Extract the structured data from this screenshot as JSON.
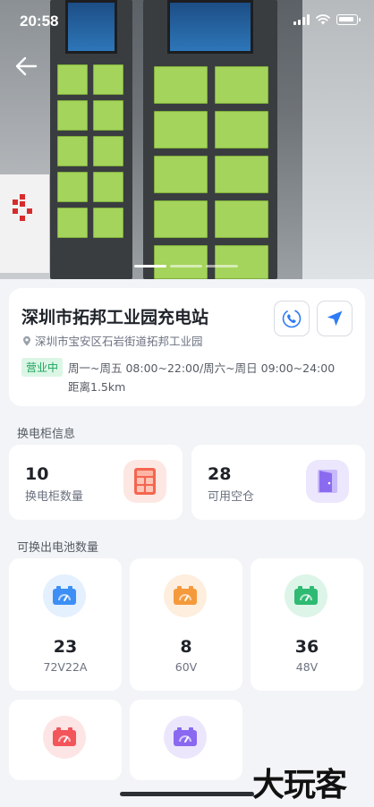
{
  "status_bar": {
    "time": "20:58"
  },
  "station": {
    "name": "深圳市拓邦工业园充电站",
    "address": "深圳市宝安区石岩街道拓邦工业园",
    "status": "营业中",
    "hours": "周一~周五 08:00~22:00/周六~周日 09:00~24:00",
    "distance": "距离1.5km"
  },
  "carousel": {
    "slide_count": 3,
    "active_index": 0
  },
  "cabinet_section": {
    "title": "换电柜信息",
    "stats": [
      {
        "value": "10",
        "label": "换电柜数量",
        "icon": "cabinet-icon",
        "color": "#f25c4f"
      },
      {
        "value": "28",
        "label": "可用空仓",
        "icon": "door-icon",
        "color": "#8a6bf0"
      }
    ]
  },
  "battery_section": {
    "title": "可换出电池数量",
    "items": [
      {
        "count": "23",
        "spec": "72V22A",
        "icon": "battery-icon",
        "color": "#3d8ff5",
        "bg": "#e4f0fe"
      },
      {
        "count": "8",
        "spec": "60V",
        "icon": "battery-icon",
        "color": "#f59a3b",
        "bg": "#fdeede"
      },
      {
        "count": "36",
        "spec": "48V",
        "icon": "battery-icon",
        "color": "#2fba73",
        "bg": "#ddf5e8"
      },
      {
        "count": "",
        "spec": "",
        "icon": "battery-icon",
        "color": "#f2555a",
        "bg": "#fde5e5"
      },
      {
        "count": "",
        "spec": "",
        "icon": "battery-icon",
        "color": "#8a68f0",
        "bg": "#ece6fd"
      }
    ]
  },
  "watermark": "大玩客"
}
